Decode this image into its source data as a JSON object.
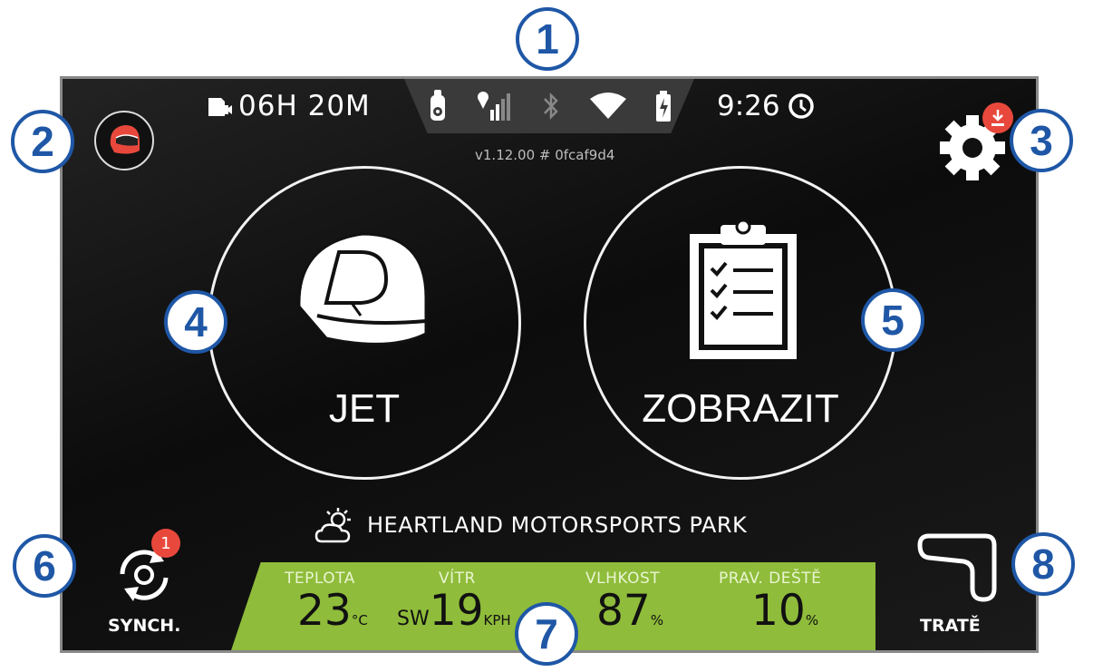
{
  "statusbar": {
    "battery_time": "06H 20M",
    "time": "9:26",
    "version": "v1.12.00 # 0fcaf9d4"
  },
  "icons": {
    "media": "sdcard-video-icon",
    "device": "device-icon",
    "gps": "gps-signal-icon",
    "bluetooth": "bluetooth-icon",
    "wifi": "wifi-icon",
    "battery": "battery-charging-icon",
    "clock": "clock-icon"
  },
  "main": {
    "jet_label": "JET",
    "view_label": "ZOBRAZIT"
  },
  "track": {
    "name": "HEARTLAND MOTORSPORTS PARK"
  },
  "weather": {
    "temperature_label": "TEPLOTA",
    "temperature_value": "23",
    "temperature_unit": "°C",
    "wind_label": "VÍTR",
    "wind_dir": "SW",
    "wind_value": "19",
    "wind_unit": "KPH",
    "humidity_label": "VLHKOST",
    "humidity_value": "87",
    "humidity_unit": "%",
    "rain_label": "PRAV. DEŠTĚ",
    "rain_value": "10",
    "rain_unit": "%"
  },
  "bottom": {
    "sync_label": "SYNCH.",
    "sync_badge": "1",
    "tracks_label": "TRATĚ"
  },
  "callouts": [
    "1",
    "2",
    "3",
    "4",
    "5",
    "6",
    "7",
    "8"
  ],
  "colors": {
    "weather_panel": "#8fbc3a",
    "badge": "#e8483c",
    "callout": "#1f57a6"
  }
}
